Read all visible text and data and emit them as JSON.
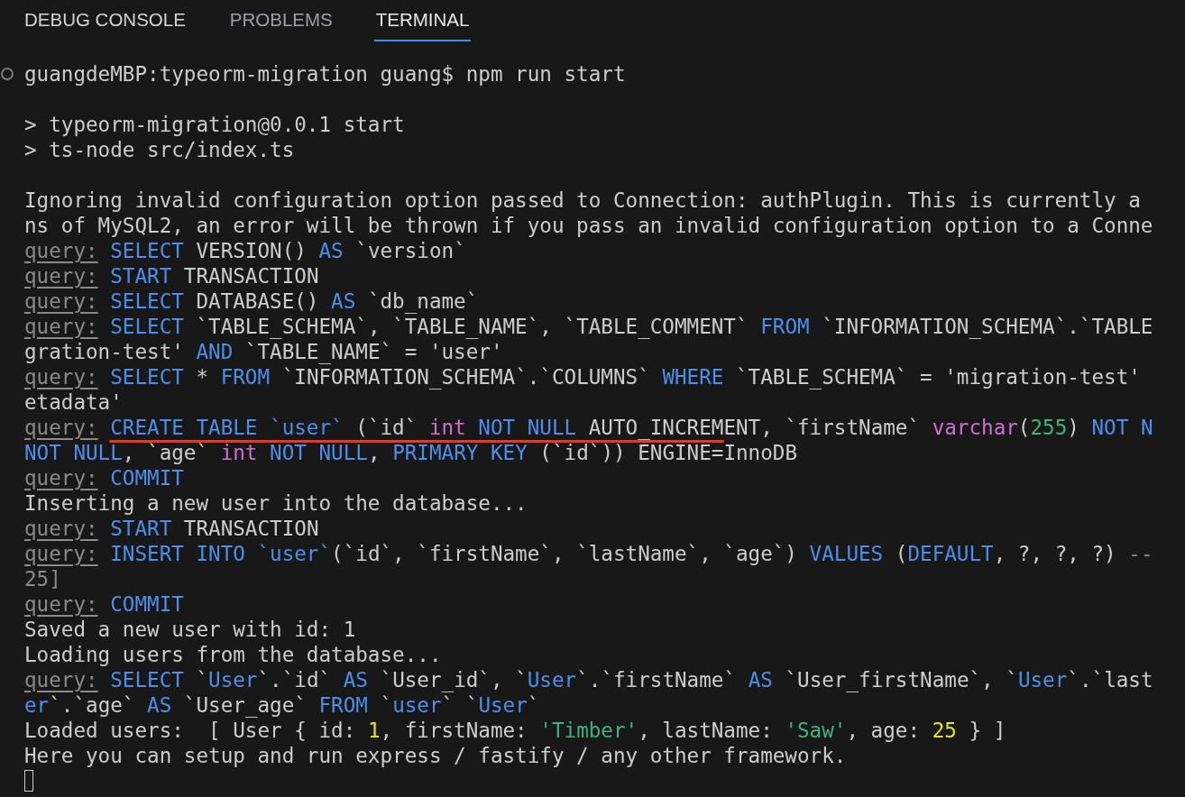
{
  "tabs": [
    {
      "label": "DEBUG CONSOLE",
      "selected": false
    },
    {
      "label": "PROBLEMS",
      "selected": false
    },
    {
      "label": "TERMINAL",
      "selected": true
    }
  ],
  "terminal": {
    "rows": [
      {
        "kind": "command",
        "segments": [
          {
            "text": "guangdeMBP:typeorm-migration guang$ npm run start",
            "kind": "plain"
          }
        ]
      },
      {
        "kind": "blank"
      },
      {
        "kind": "output",
        "segments": [
          {
            "text": "> typeorm-migration@0.0.1 start",
            "kind": "plain"
          }
        ]
      },
      {
        "kind": "output",
        "segments": [
          {
            "text": "> ts-node src/index.ts",
            "kind": "plain"
          }
        ]
      },
      {
        "kind": "blank"
      },
      {
        "kind": "output",
        "segments": [
          {
            "text": "Ignoring invalid configuration option passed to Connection: authPlugin. This is currently a",
            "kind": "plain"
          }
        ]
      },
      {
        "kind": "output",
        "segments": [
          {
            "text": "ns of MySQL2, an error will be thrown if you pass an invalid configuration option to a Conne",
            "kind": "plain"
          }
        ]
      },
      {
        "kind": "output",
        "segments": [
          {
            "text": "query:",
            "kind": "label"
          },
          {
            "text": " SELECT",
            "kind": "keyword"
          },
          {
            "text": " VERSION() ",
            "kind": "plain"
          },
          {
            "text": "AS",
            "kind": "keyword"
          },
          {
            "text": " `version`",
            "kind": "plain"
          }
        ]
      },
      {
        "kind": "output",
        "segments": [
          {
            "text": "query:",
            "kind": "label"
          },
          {
            "text": " START",
            "kind": "keyword"
          },
          {
            "text": " TRANSACTION",
            "kind": "plain"
          }
        ]
      },
      {
        "kind": "output",
        "segments": [
          {
            "text": "query:",
            "kind": "label"
          },
          {
            "text": " SELECT",
            "kind": "keyword"
          },
          {
            "text": " DATABASE() ",
            "kind": "plain"
          },
          {
            "text": "AS",
            "kind": "keyword"
          },
          {
            "text": " `db_name`",
            "kind": "plain"
          }
        ]
      },
      {
        "kind": "output",
        "segments": [
          {
            "text": "query:",
            "kind": "label"
          },
          {
            "text": " SELECT",
            "kind": "keyword"
          },
          {
            "text": " `TABLE_SCHEMA`, `TABLE_NAME`, `TABLE_COMMENT` ",
            "kind": "plain"
          },
          {
            "text": "FROM",
            "kind": "keyword"
          },
          {
            "text": " `INFORMATION_SCHEMA`.`TABLE",
            "kind": "plain"
          }
        ]
      },
      {
        "kind": "output",
        "segments": [
          {
            "text": "gration-test' ",
            "kind": "plain"
          },
          {
            "text": "AND",
            "kind": "keyword"
          },
          {
            "text": " `TABLE_NAME` = 'user'",
            "kind": "plain"
          }
        ]
      },
      {
        "kind": "output",
        "segments": [
          {
            "text": "query:",
            "kind": "label"
          },
          {
            "text": " SELECT",
            "kind": "keyword"
          },
          {
            "text": " * ",
            "kind": "plain"
          },
          {
            "text": "FROM",
            "kind": "keyword"
          },
          {
            "text": " `INFORMATION_SCHEMA`.`COLUMNS` ",
            "kind": "plain"
          },
          {
            "text": "WHERE",
            "kind": "keyword"
          },
          {
            "text": " `TABLE_SCHEMA` = 'migration-test'",
            "kind": "plain"
          }
        ]
      },
      {
        "kind": "output",
        "segments": [
          {
            "text": "etadata'",
            "kind": "plain"
          }
        ]
      },
      {
        "kind": "output",
        "segments": [
          {
            "text": "query:",
            "kind": "label"
          },
          {
            "text": " CREATE TABLE `user`",
            "kind": "keyword",
            "underlined": true
          },
          {
            "text": " (`id` ",
            "kind": "plain",
            "underlined": true
          },
          {
            "text": "int ",
            "kind": "type",
            "underlined": true
          },
          {
            "text": "NOT NULL",
            "kind": "keyword",
            "underlined": true
          },
          {
            "text": " AUTO_INCREMENT",
            "kind": "plain",
            "underlined": true
          },
          {
            "text": ", `firstName` ",
            "kind": "plain"
          },
          {
            "text": "varchar",
            "kind": "type"
          },
          {
            "text": "(",
            "kind": "plain"
          },
          {
            "text": "255",
            "kind": "literal"
          },
          {
            "text": ") ",
            "kind": "plain"
          },
          {
            "text": "NOT N",
            "kind": "keyword"
          }
        ]
      },
      {
        "kind": "output",
        "segments": [
          {
            "text": "NOT NULL",
            "kind": "keyword"
          },
          {
            "text": ", `age` ",
            "kind": "plain"
          },
          {
            "text": "int",
            "kind": "type"
          },
          {
            "text": " NOT NULL",
            "kind": "keyword"
          },
          {
            "text": ", ",
            "kind": "plain"
          },
          {
            "text": "PRIMARY KEY",
            "kind": "keyword"
          },
          {
            "text": " (`id`)) ENGINE=InnoDB",
            "kind": "plain"
          }
        ]
      },
      {
        "kind": "output",
        "segments": [
          {
            "text": "query:",
            "kind": "label"
          },
          {
            "text": " COMMIT",
            "kind": "keyword"
          }
        ]
      },
      {
        "kind": "output",
        "segments": [
          {
            "text": "Inserting a new user into the database...",
            "kind": "plain"
          }
        ]
      },
      {
        "kind": "output",
        "segments": [
          {
            "text": "query:",
            "kind": "label"
          },
          {
            "text": " START",
            "kind": "keyword"
          },
          {
            "text": " TRANSACTION",
            "kind": "plain"
          }
        ]
      },
      {
        "kind": "output",
        "segments": [
          {
            "text": "query:",
            "kind": "label"
          },
          {
            "text": " INSERT INTO `user`",
            "kind": "keyword"
          },
          {
            "text": "(`id`, `firstName`, `lastName`, `age`) ",
            "kind": "plain"
          },
          {
            "text": "VALUES",
            "kind": "keyword"
          },
          {
            "text": " (",
            "kind": "plain"
          },
          {
            "text": "DEFAULT",
            "kind": "keyword"
          },
          {
            "text": ", ?, ?, ?) ",
            "kind": "plain"
          },
          {
            "text": "--",
            "kind": "dim"
          }
        ]
      },
      {
        "kind": "output",
        "segments": [
          {
            "text": "25]",
            "kind": "dim"
          }
        ]
      },
      {
        "kind": "output",
        "segments": [
          {
            "text": "query:",
            "kind": "label"
          },
          {
            "text": " COMMIT",
            "kind": "keyword"
          }
        ]
      },
      {
        "kind": "output",
        "segments": [
          {
            "text": "Saved a new user with id: 1",
            "kind": "plain"
          }
        ]
      },
      {
        "kind": "output",
        "segments": [
          {
            "text": "Loading users from the database...",
            "kind": "plain"
          }
        ]
      },
      {
        "kind": "output",
        "segments": [
          {
            "text": "query:",
            "kind": "label"
          },
          {
            "text": " SELECT",
            "kind": "keyword"
          },
          {
            "text": " `",
            "kind": "plain"
          },
          {
            "text": "User",
            "kind": "keyword"
          },
          {
            "text": "`.`id` ",
            "kind": "plain"
          },
          {
            "text": "AS",
            "kind": "keyword"
          },
          {
            "text": " `User_id`, `",
            "kind": "plain"
          },
          {
            "text": "User",
            "kind": "keyword"
          },
          {
            "text": "`.`firstName` ",
            "kind": "plain"
          },
          {
            "text": "AS",
            "kind": "keyword"
          },
          {
            "text": " `User_firstName`, `",
            "kind": "plain"
          },
          {
            "text": "User",
            "kind": "keyword"
          },
          {
            "text": "`.`last",
            "kind": "plain"
          }
        ]
      },
      {
        "kind": "output",
        "segments": [
          {
            "text": "er",
            "kind": "keyword"
          },
          {
            "text": "`.`age` ",
            "kind": "plain"
          },
          {
            "text": "AS",
            "kind": "keyword"
          },
          {
            "text": " `User_age` ",
            "kind": "plain"
          },
          {
            "text": "FROM",
            "kind": "keyword"
          },
          {
            "text": " `",
            "kind": "plain"
          },
          {
            "text": "user",
            "kind": "keyword"
          },
          {
            "text": "` `",
            "kind": "plain"
          },
          {
            "text": "User",
            "kind": "keyword"
          },
          {
            "text": "`",
            "kind": "plain"
          }
        ]
      },
      {
        "kind": "output",
        "segments": [
          {
            "text": "Loaded users:  [ User { id: ",
            "kind": "plain"
          },
          {
            "text": "1",
            "kind": "number"
          },
          {
            "text": ", firstName: ",
            "kind": "plain"
          },
          {
            "text": "'Timber'",
            "kind": "literal"
          },
          {
            "text": ", lastName: ",
            "kind": "plain"
          },
          {
            "text": "'Saw'",
            "kind": "literal"
          },
          {
            "text": ", age: ",
            "kind": "plain"
          },
          {
            "text": "25",
            "kind": "number"
          },
          {
            "text": " } ]",
            "kind": "plain"
          }
        ]
      },
      {
        "kind": "output",
        "segments": [
          {
            "text": "Here you can setup and run express / fastify / any other framework.",
            "kind": "plain"
          }
        ]
      },
      {
        "kind": "cursor"
      }
    ]
  }
}
